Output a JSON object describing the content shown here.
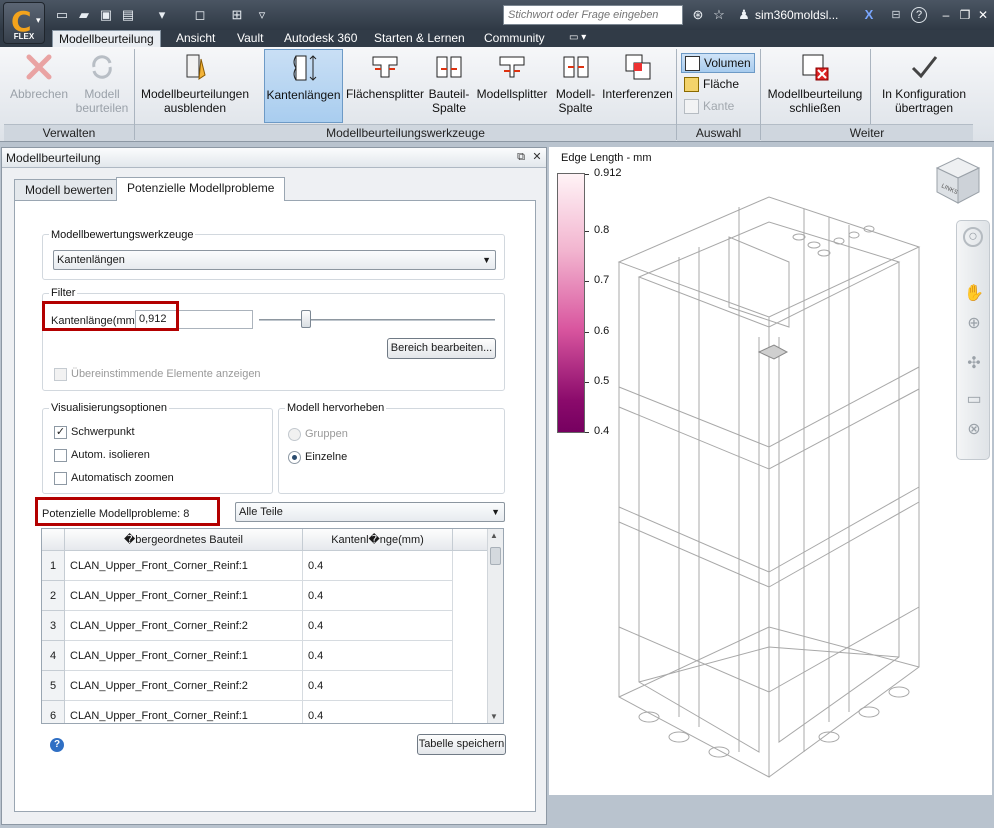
{
  "titlebar": {
    "app_label": "FLEX",
    "search_placeholder": "Stichwort oder Frage eingeben",
    "user": "sim360moldsl...",
    "help": "?"
  },
  "tabs": [
    {
      "label": "Modellbeurteilung",
      "active": true
    },
    {
      "label": "Ansicht"
    },
    {
      "label": "Vault"
    },
    {
      "label": "Autodesk 360"
    },
    {
      "label": "Starten & Lernen"
    },
    {
      "label": "Community"
    }
  ],
  "ribbon": {
    "abbrechen": "Abbrechen",
    "modell_beurteilen_1": "Modell",
    "modell_beurteilen_2": "beurteilen",
    "ausblenden_1": "Modellbeurteilungen",
    "ausblenden_2": "ausblenden",
    "kantenlaengen": "Kantenlängen",
    "flaechensplitter": "Flächensplitter",
    "bauteilspalte_1": "Bauteil-",
    "bauteilspalte_2": "Spalte",
    "modellsplitter": "Modellsplitter",
    "modellspalte_1": "Modell-",
    "modellspalte_2": "Spalte",
    "interferenzen": "Interferenzen",
    "volumen": "Volumen",
    "flaeche": "Fläche",
    "kante": "Kante",
    "schliessen_1": "Modellbeurteilung",
    "schliessen_2": "schließen",
    "konfiguration_1": "In Konfiguration",
    "konfiguration_2": "übertragen",
    "groups": {
      "verwalten": "Verwalten",
      "werkzeuge": "Modellbeurteilungswerkzeuge",
      "auswahl": "Auswahl",
      "weiter": "Weiter"
    }
  },
  "panel": {
    "title": "Modellbeurteilung",
    "tab_bewerten": "Modell bewerten",
    "tab_probleme": "Potenzielle Modellprobleme",
    "werkzeuge_title": "Modellbewertungswerkzeuge",
    "werkzeug_value": "Kantenlängen",
    "filter_title": "Filter",
    "kantenlaenge_label": "Kantenlänge(mm)",
    "kantenlaenge_value": "0,912",
    "slider_value": 0.62,
    "bereich_button": "Bereich bearbeiten...",
    "uebereinstimmende": "Übereinstimmende Elemente anzeigen",
    "vis_title": "Visualisierungsoptionen",
    "schwerpunkt": "Schwerpunkt",
    "isolieren": "Autom. isolieren",
    "zoomen": "Automatisch zoomen",
    "hervorheben_title": "Modell hervorheben",
    "gruppen": "Gruppen",
    "einzelne": "Einzelne",
    "probleme_label": "Potenzielle Modellprobleme: 8",
    "teile_select": "Alle Teile",
    "table_headers": [
      "�bergeordnetes Bauteil",
      "Kantenl�nge(mm)"
    ],
    "rows": [
      {
        "n": "1",
        "part": "CLAN_Upper_Front_Corner_Reinf:1",
        "len": "0.4"
      },
      {
        "n": "2",
        "part": "CLAN_Upper_Front_Corner_Reinf:1",
        "len": "0.4"
      },
      {
        "n": "3",
        "part": "CLAN_Upper_Front_Corner_Reinf:2",
        "len": "0.4"
      },
      {
        "n": "4",
        "part": "CLAN_Upper_Front_Corner_Reinf:1",
        "len": "0.4"
      },
      {
        "n": "5",
        "part": "CLAN_Upper_Front_Corner_Reinf:2",
        "len": "0.4"
      },
      {
        "n": "6",
        "part": "CLAN_Upper_Front_Corner_Reinf:1",
        "len": "0.4"
      }
    ],
    "save_button": "Tabelle speichern"
  },
  "legend": {
    "title": "Edge Length - mm",
    "ticks": [
      "0.912",
      "0.8",
      "0.7",
      "0.6",
      "0.5",
      "0.4"
    ]
  },
  "viewcube": {
    "label": "LINKS"
  },
  "colors": {
    "accent": "#b30000",
    "selected": "#a9cdef",
    "legend_top": "#fff3f6",
    "legend_bottom": "#760060"
  }
}
